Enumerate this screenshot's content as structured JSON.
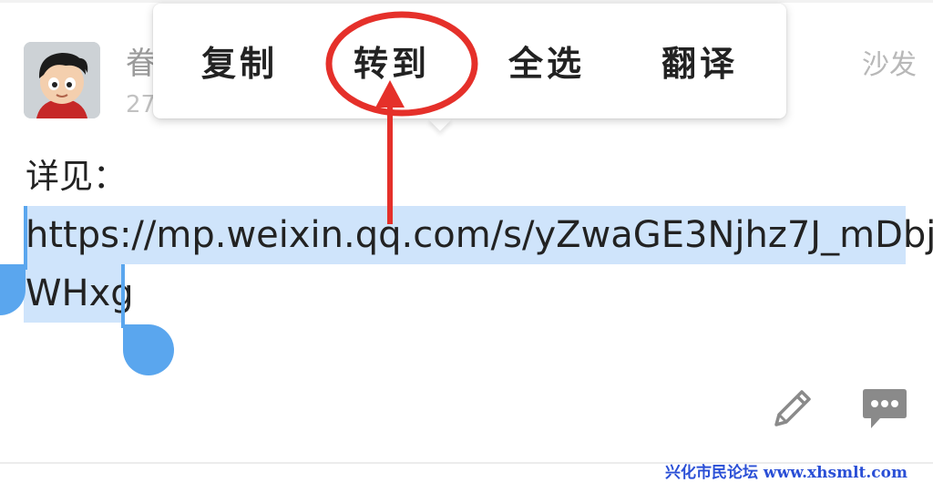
{
  "post": {
    "username_visible": "眷",
    "time_visible": "27",
    "floor_label": "沙发",
    "body_label": "详见：",
    "link_line1": "https://mp.weixin.qq.com/s/yZwaGE3Njhz7J_mDbj",
    "link_line2": "WHxg"
  },
  "context_menu": {
    "items": [
      {
        "label": "复制"
      },
      {
        "label": "转到"
      },
      {
        "label": "全选"
      },
      {
        "label": "翻译"
      }
    ],
    "highlighted_item": "转到"
  },
  "actions": {
    "edit_icon": "pencil-icon",
    "comment_icon": "comment-bubble-icon"
  },
  "watermark": "兴化市民论坛  www.xhsmlt.com",
  "colors": {
    "selection": "#cfe4fb",
    "handle": "#5aa6ee",
    "annotation": "#e5302a",
    "watermark": "#2a4fd6"
  }
}
